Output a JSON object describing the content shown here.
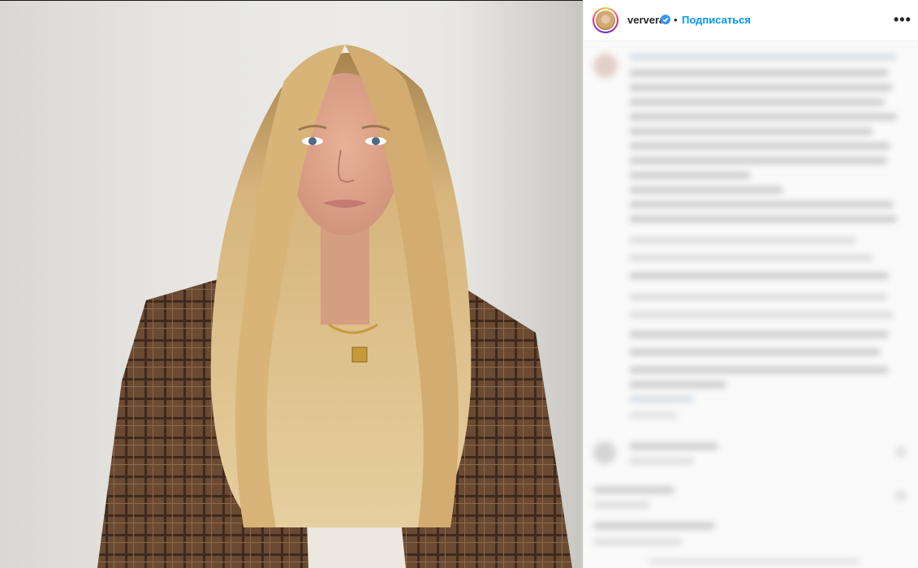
{
  "post": {
    "username": "ververa",
    "separator": "•",
    "follow_label": "Подписаться",
    "more_label": "•••",
    "verified": true,
    "accent_color": "#0095f6"
  },
  "icons": {
    "verified": "verified-badge-icon",
    "more": "more-options-icon"
  },
  "colors": {
    "follow": "#0095f6",
    "text": "#262626",
    "panel_bg": "#fafafa"
  }
}
